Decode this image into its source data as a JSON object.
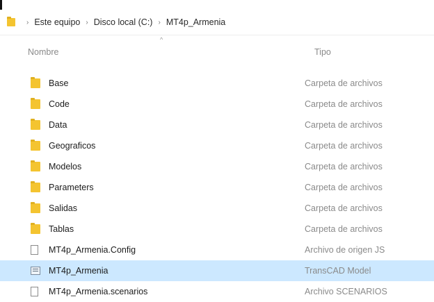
{
  "breadcrumb": {
    "items": [
      "Este equipo",
      "Disco local (C:)",
      "MT4p_Armenia"
    ],
    "separator": "›"
  },
  "columns": {
    "name": "Nombre",
    "type": "Tipo",
    "sort_caret": "^"
  },
  "files": [
    {
      "name": "Base",
      "type": "Carpeta de archivos",
      "icon": "folder-icon"
    },
    {
      "name": "Code",
      "type": "Carpeta de archivos",
      "icon": "folder-icon"
    },
    {
      "name": "Data",
      "type": "Carpeta de archivos",
      "icon": "folder-icon"
    },
    {
      "name": "Geograficos",
      "type": "Carpeta de archivos",
      "icon": "folder-icon"
    },
    {
      "name": "Modelos",
      "type": "Carpeta de archivos",
      "icon": "folder-icon"
    },
    {
      "name": "Parameters",
      "type": "Carpeta de archivos",
      "icon": "folder-icon"
    },
    {
      "name": "Salidas",
      "type": "Carpeta de archivos",
      "icon": "folder-icon"
    },
    {
      "name": "Tablas",
      "type": "Carpeta de archivos",
      "icon": "folder-icon"
    },
    {
      "name": "MT4p_Armenia.Config",
      "type": "Archivo de origen JS",
      "icon": "document-icon"
    },
    {
      "name": "MT4p_Armenia",
      "type": "TransCAD Model",
      "icon": "model-file-icon",
      "selected": true
    },
    {
      "name": "MT4p_Armenia.scenarios",
      "type": "Archivo SCENARIOS",
      "icon": "document-icon"
    }
  ],
  "colors": {
    "selection": "#cce8ff",
    "folder": "#f4c430"
  }
}
